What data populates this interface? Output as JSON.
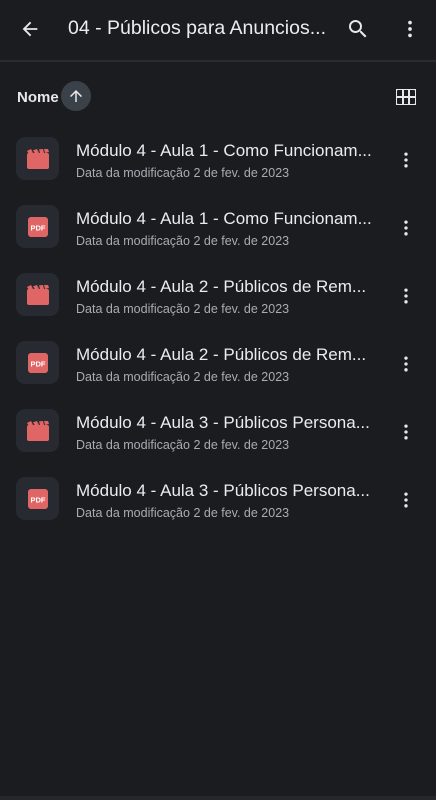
{
  "header": {
    "title": "04 - Públicos para Anuncios...",
    "back_icon": "arrow-back-icon",
    "search_icon": "search-icon",
    "more_icon": "more-vert-icon"
  },
  "sort": {
    "label": "Nome",
    "direction_icon": "arrow-up-icon",
    "view_toggle_icon": "grid-view-icon"
  },
  "colors": {
    "background": "#1b1c20",
    "thumb_bg": "#272a31",
    "file_icon_accent": "#e06666",
    "sort_button_bg": "#3b4148"
  },
  "files": [
    {
      "name": "Módulo 4 - Aula 1 - Como Funcionam...",
      "meta_label": "Data da modificação",
      "meta_date": "2 de fev. de 2023",
      "type": "video"
    },
    {
      "name": "Módulo 4 - Aula 1 - Como Funcionam...",
      "meta_label": "Data da modificação",
      "meta_date": "2 de fev. de 2023",
      "type": "pdf"
    },
    {
      "name": "Módulo 4 - Aula 2 - Públicos de Rem...",
      "meta_label": "Data da modificação",
      "meta_date": "2 de fev. de 2023",
      "type": "video"
    },
    {
      "name": "Módulo 4 - Aula 2 - Públicos de Rem...",
      "meta_label": "Data da modificação",
      "meta_date": "2 de fev. de 2023",
      "type": "pdf"
    },
    {
      "name": "Módulo 4 - Aula 3 - Públicos Persona...",
      "meta_label": "Data da modificação",
      "meta_date": "2 de fev. de 2023",
      "type": "video"
    },
    {
      "name": "Módulo 4 - Aula 3 - Públicos Persona...",
      "meta_label": "Data da modificação",
      "meta_date": "2 de fev. de 2023",
      "type": "pdf"
    }
  ],
  "pdf_badge_text": "PDF"
}
